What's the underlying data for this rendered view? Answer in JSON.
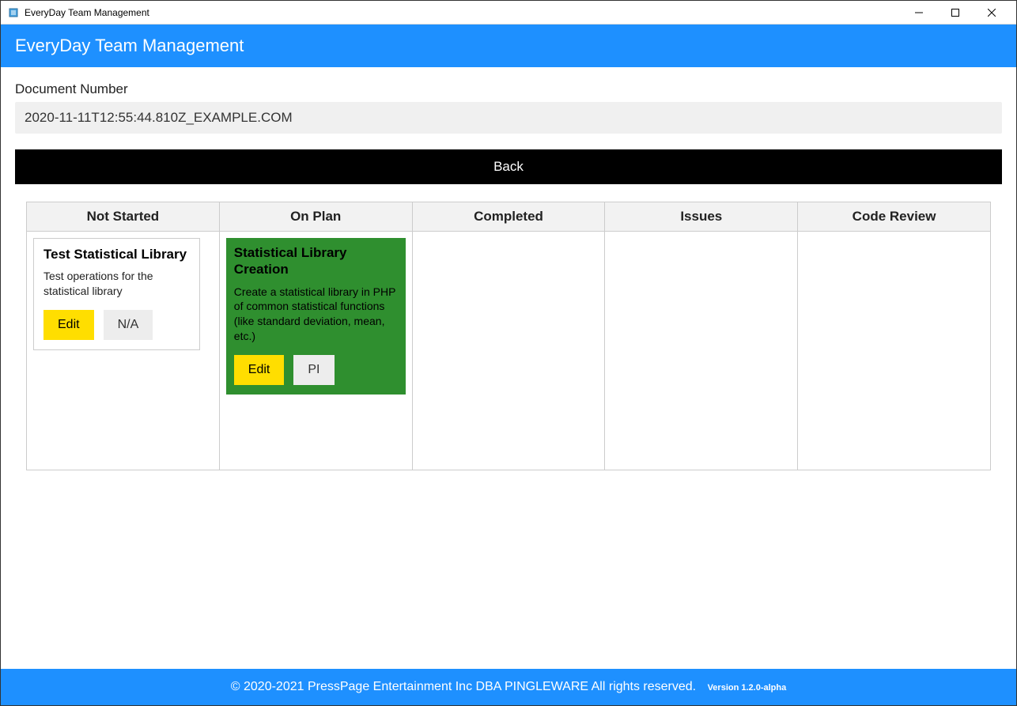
{
  "window": {
    "title": "EveryDay Team Management"
  },
  "header": {
    "title": "EveryDay Team Management"
  },
  "document": {
    "label": "Document Number",
    "value": "2020-11-11T12:55:44.810Z_EXAMPLE.COM"
  },
  "buttons": {
    "back": "Back"
  },
  "columns": {
    "not_started": "Not Started",
    "on_plan": "On Plan",
    "completed": "Completed",
    "issues": "Issues",
    "code_review": "Code Review"
  },
  "cards": {
    "card1": {
      "title": "Test Statistical Library",
      "desc": "Test operations for the statistical library",
      "edit": "Edit",
      "second": "N/A"
    },
    "card2": {
      "title": "Statistical Library Creation",
      "desc": "Create a statistical library in PHP of common statistical functions (like standard deviation, mean, etc.)",
      "edit": "Edit",
      "second": "PI"
    }
  },
  "footer": {
    "copyright": "© 2020-2021 PressPage Entertainment Inc DBA PINGLEWARE  All rights reserved.",
    "version": "Version 1.2.0-alpha"
  }
}
